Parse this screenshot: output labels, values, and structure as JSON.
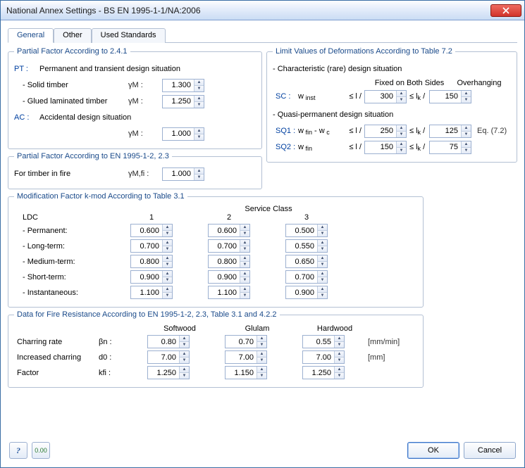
{
  "window": {
    "title": "National Annex Settings - BS EN 1995-1-1/NA:2006"
  },
  "tabs": {
    "general": "General",
    "other": "Other",
    "used": "Used Standards"
  },
  "pf241": {
    "legend": "Partial Factor According to 2.4.1",
    "pt_code": "PT :",
    "pt_label": "Permanent and transient design situation",
    "solid_label": "- Solid timber",
    "glulam_label": "- Glued laminated timber",
    "ac_code": "AC :",
    "ac_label": "Accidental design situation",
    "gammaM": "γM :",
    "solid_val": "1.300",
    "glulam_val": "1.250",
    "ac_val": "1.000"
  },
  "pf_fire": {
    "legend": "Partial Factor According to EN 1995-1-2, 2.3",
    "label": "For timber in fire",
    "sym": "γM,fi :",
    "val": "1.000"
  },
  "def": {
    "legend": "Limit Values of Deformations According to Table 7.2",
    "char_label": "- Characteristic (rare) design situation",
    "qp_label": "- Quasi-permanent design situation",
    "hdr_fixed": "Fixed on Both Sides",
    "hdr_over": "Overhanging",
    "le_l": "≤ l /",
    "le_lk": "≤ lk /",
    "sc_code": "SC :",
    "sc_desc": "w inst",
    "sc_v1": "300",
    "sc_v2": "150",
    "sq1_code": "SQ1 :",
    "sq1_desc": "w fin - w c",
    "sq1_v1": "250",
    "sq1_v2": "125",
    "sq1_eq": "Eq. (7.2)",
    "sq2_code": "SQ2 :",
    "sq2_desc": "w fin",
    "sq2_v1": "150",
    "sq2_v2": "75"
  },
  "kmod": {
    "legend": "Modification Factor k-mod According to Table 3.1",
    "ldc": "LDC",
    "sc": "Service Class",
    "c1": "1",
    "c2": "2",
    "c3": "3",
    "rows": [
      {
        "label": "- Permanent:",
        "v1": "0.600",
        "v2": "0.600",
        "v3": "0.500"
      },
      {
        "label": "- Long-term:",
        "v1": "0.700",
        "v2": "0.700",
        "v3": "0.550"
      },
      {
        "label": "- Medium-term:",
        "v1": "0.800",
        "v2": "0.800",
        "v3": "0.650"
      },
      {
        "label": "- Short-term:",
        "v1": "0.900",
        "v2": "0.900",
        "v3": "0.700"
      },
      {
        "label": "- Instantaneous:",
        "v1": "1.100",
        "v2": "1.100",
        "v3": "0.900"
      }
    ]
  },
  "fire": {
    "legend": "Data for Fire Resistance According to EN 1995-1-2, 2.3, Table 3.1 and 4.2.2",
    "h_soft": "Softwood",
    "h_glu": "Glulam",
    "h_hard": "Hardwood",
    "r1": {
      "label": "Charring rate",
      "sym": "βn :",
      "v1": "0.80",
      "v2": "0.70",
      "v3": "0.55",
      "unit": "[mm/min]"
    },
    "r2": {
      "label": "Increased charring",
      "sym": "d0 :",
      "v1": "7.00",
      "v2": "7.00",
      "v3": "7.00",
      "unit": "[mm]"
    },
    "r3": {
      "label": "Factor",
      "sym": "kfi :",
      "v1": "1.250",
      "v2": "1.150",
      "v3": "1.250",
      "unit": ""
    }
  },
  "footer": {
    "ok": "OK",
    "cancel": "Cancel"
  }
}
